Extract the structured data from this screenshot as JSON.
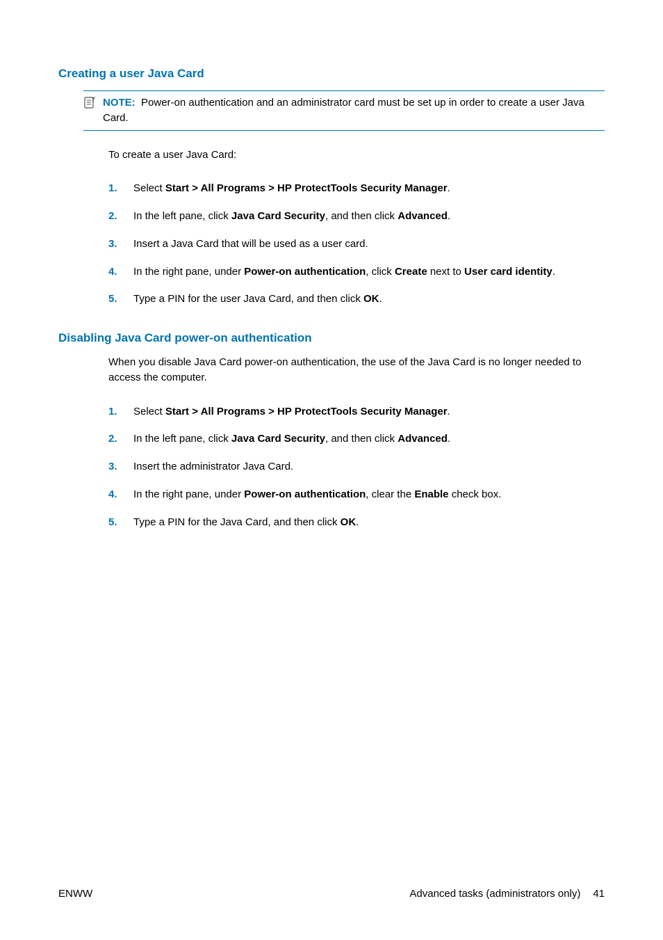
{
  "sections": [
    {
      "heading": "Creating a user Java Card",
      "note": {
        "label": "NOTE:",
        "text": "Power-on authentication and an administrator card must be set up in order to create a user Java Card."
      },
      "intro": "To create a user Java Card:",
      "steps": [
        {
          "n": "1.",
          "prefix": "Select ",
          "bold1": "Start > All Programs > HP ProtectTools Security Manager",
          "suffix": "."
        },
        {
          "n": "2.",
          "prefix": "In the left pane, click ",
          "bold1": "Java Card Security",
          "mid": ", and then click ",
          "bold2": "Advanced",
          "suffix": "."
        },
        {
          "n": "3.",
          "prefix": "Insert a Java Card that will be used as a user card.",
          "bold1": "",
          "suffix": ""
        },
        {
          "n": "4.",
          "prefix": "In the right pane, under ",
          "bold1": "Power-on authentication",
          "mid": ", click ",
          "bold2": "Create",
          "mid2": " next to ",
          "bold3": "User card identity",
          "suffix": "."
        },
        {
          "n": "5.",
          "prefix": "Type a PIN for the user Java Card, and then click ",
          "bold1": "OK",
          "suffix": "."
        }
      ]
    },
    {
      "heading": "Disabling Java Card power-on authentication",
      "intro": "When you disable Java Card power-on authentication, the use of the Java Card is no longer needed to access the computer.",
      "steps": [
        {
          "n": "1.",
          "prefix": "Select ",
          "bold1": "Start > All Programs > HP ProtectTools Security Manager",
          "suffix": "."
        },
        {
          "n": "2.",
          "prefix": "In the left pane, click ",
          "bold1": "Java Card Security",
          "mid": ", and then click ",
          "bold2": "Advanced",
          "suffix": "."
        },
        {
          "n": "3.",
          "prefix": "Insert the administrator Java Card.",
          "bold1": "",
          "suffix": ""
        },
        {
          "n": "4.",
          "prefix": "In the right pane, under ",
          "bold1": "Power-on authentication",
          "mid": ", clear the ",
          "bold2": "Enable",
          "suffix": " check box."
        },
        {
          "n": "5.",
          "prefix": "Type a PIN for the Java Card, and then click ",
          "bold1": "OK",
          "suffix": "."
        }
      ]
    }
  ],
  "footer": {
    "left": "ENWW",
    "right_text": "Advanced tasks (administrators only)",
    "page": "41"
  }
}
